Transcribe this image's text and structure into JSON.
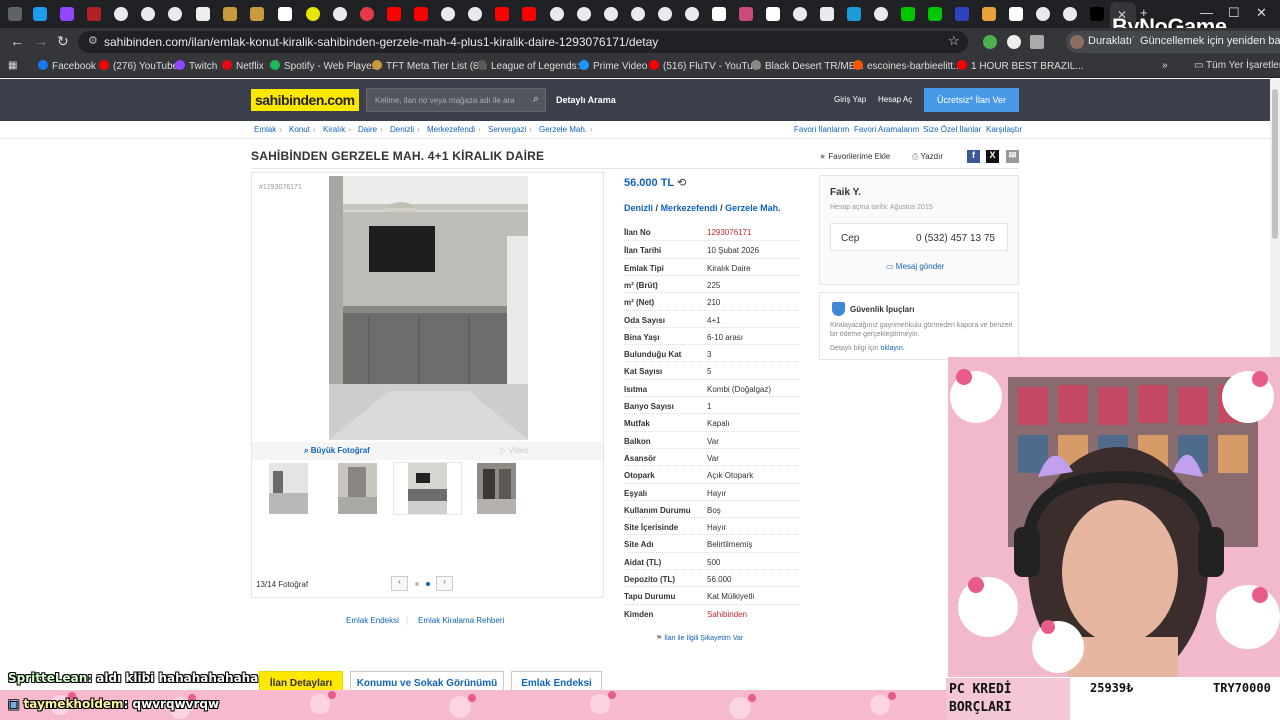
{
  "browser": {
    "url": "sahibinden.com/ilan/emlak-konut-kiralik-sahibinden-gerzele-mah-4-plus1-kiralik-daire-1293076171/detay",
    "profile_label": "Duraklatıldı",
    "update_label": "Güncellemek için yeniden başlat",
    "bookmarks": [
      {
        "label": "Facebook",
        "color": "#1877f2"
      },
      {
        "label": "(276) YouTube",
        "color": "#ff0000"
      },
      {
        "label": "Twitch",
        "color": "#9146ff"
      },
      {
        "label": "Netflix",
        "color": "#e50914"
      },
      {
        "label": "Spotify - Web Playe...",
        "color": "#1db954"
      },
      {
        "label": "TFT Meta Tier List (8...",
        "color": "#c89b3c"
      },
      {
        "label": "League of Legends:...",
        "color": "#5b5a56"
      },
      {
        "label": "Prime Video",
        "color": "#1a98ff"
      },
      {
        "label": "(516) FluTV - YouTu...",
        "color": "#ff0000"
      },
      {
        "label": "Black Desert TR/ME...",
        "color": "#888888"
      },
      {
        "label": "escoines-barbieelitt...",
        "color": "#ff5500"
      },
      {
        "label": "1 HOUR BEST BRAZIL...",
        "color": "#ff0000"
      }
    ],
    "all_bookmarks_label": "Tüm Yer İşaretleri"
  },
  "watermark": "ByNoGame",
  "header": {
    "logo": "sahibinden.com",
    "search_placeholder": "Kelime, ilan no veya mağaza adı ile ara",
    "advanced_search": "Detaylı Arama",
    "login": "Giriş Yap",
    "register": "Hesap Aç",
    "post_ad": "Ücretsiz* İlan Ver"
  },
  "breadcrumb": [
    "Emlak",
    "Konut",
    "Kiralık",
    "Daire",
    "Denizli",
    "Merkezefendi",
    "Servergazi",
    "Gerzele Mah."
  ],
  "breadcrumb_right": [
    "Favori İlanlarım",
    "Favori Aramalarım",
    "Size Özel İlanlar",
    "Karşılaştır"
  ],
  "listing": {
    "title": "SAHİBİNDEN GERZELE MAH. 4+1 KİRALIK DAİRE",
    "favorite": "Favorilerime Ekle",
    "print": "Yazdır",
    "id_tag": "#1293076171",
    "price": "56.000 TL",
    "location": [
      "Denizli",
      "Merkezefendi",
      "Gerzele Mah."
    ],
    "details": [
      {
        "label": "İlan No",
        "value": "1293076171",
        "red": true
      },
      {
        "label": "İlan Tarihi",
        "value": "10 Şubat 2026"
      },
      {
        "label": "Emlak Tipi",
        "value": "Kiralık Daire"
      },
      {
        "label": "m² (Brüt)",
        "value": "225"
      },
      {
        "label": "m² (Net)",
        "value": "210"
      },
      {
        "label": "Oda Sayısı",
        "value": "4+1"
      },
      {
        "label": "Bina Yaşı",
        "value": "6-10 arası"
      },
      {
        "label": "Bulunduğu Kat",
        "value": "3"
      },
      {
        "label": "Kat Sayısı",
        "value": "5"
      },
      {
        "label": "Isıtma",
        "value": "Kombi (Doğalgaz)"
      },
      {
        "label": "Banyo Sayısı",
        "value": "1"
      },
      {
        "label": "Mutfak",
        "value": "Kapalı"
      },
      {
        "label": "Balkon",
        "value": "Var"
      },
      {
        "label": "Asansör",
        "value": "Var"
      },
      {
        "label": "Otopark",
        "value": "Açık Otopark"
      },
      {
        "label": "Eşyalı",
        "value": "Hayır"
      },
      {
        "label": "Kullanım Durumu",
        "value": "Boş"
      },
      {
        "label": "Site İçerisinde",
        "value": "Hayır"
      },
      {
        "label": "Site Adı",
        "value": "Belirtilmemiş"
      },
      {
        "label": "Aidat (TL)",
        "value": "500"
      },
      {
        "label": "Depozito (TL)",
        "value": "56.000"
      },
      {
        "label": "Tapu Durumu",
        "value": "Kat Mülkiyetli"
      },
      {
        "label": "Kimden",
        "value": "Sahibinden",
        "red": true
      }
    ],
    "report": "İlan ile İlgili Şikayetim Var",
    "gallery": {
      "big_photo": "Büyük Fotoğraf",
      "video": "Video",
      "count": "13/14 Fotoğraf",
      "active_thumb": 3
    }
  },
  "seller": {
    "name": "Faik Y.",
    "since": "Hesap açma tarihi: Ağustos 2015",
    "phone_label": "Cep",
    "phone": "0 (532) 457 13 75",
    "message": "Mesaj gönder"
  },
  "security": {
    "title": "Güvenlik İpuçları",
    "body": "Kiralayacağınız gayrimenkulu görmeden kapora ve benzeri bir ödeme gerçekleştirmeyin.",
    "link_prefix": "Detaylı bilgi için",
    "link": "tıklayın."
  },
  "footer_links": [
    "Emlak Endeksi",
    "Emlak Kiralama Rehberi"
  ],
  "bottom_tabs": [
    "İlan Detayları",
    "Konumu ve Sokak Görünümü",
    "Emlak Endeksi"
  ],
  "stream": {
    "chat": [
      {
        "user": "SpritteLean",
        "message": ": aldı klibi hahahahahaha"
      },
      {
        "user": "taymekholdem",
        "message": ": qwvrqwvrqw"
      }
    ],
    "pc_label_1": "PC KREDİ",
    "pc_label_2": "BORÇLARI",
    "amount_1": "25939₺",
    "amount_2": "TRY70000"
  }
}
